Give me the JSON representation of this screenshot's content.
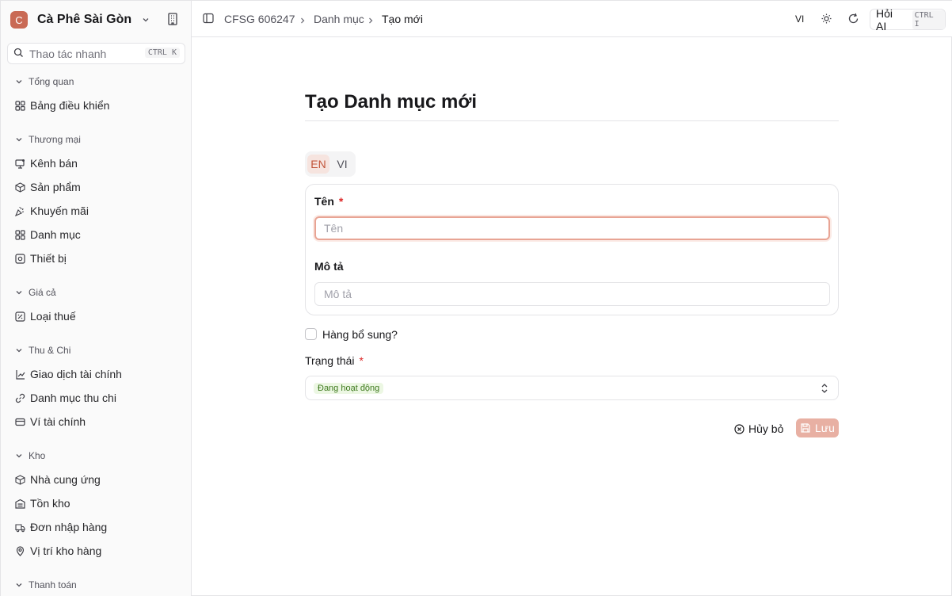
{
  "sidebar": {
    "brand": {
      "logo_letter": "C",
      "name": "Cà Phê Sài Gòn ..."
    },
    "search": {
      "placeholder": "Thao tác nhanh",
      "shortcut": "CTRL K"
    },
    "groups": [
      {
        "label": "Tổng quan",
        "items": [
          {
            "label": "Bảng điều khiển",
            "icon": "dashboard-icon"
          }
        ]
      },
      {
        "label": "Thương mại",
        "items": [
          {
            "label": "Kênh bán",
            "icon": "sales-channel-icon"
          },
          {
            "label": "Sản phẩm",
            "icon": "package-icon"
          },
          {
            "label": "Khuyến mãi",
            "icon": "party-popper-icon"
          },
          {
            "label": "Danh mục",
            "icon": "grid-icon"
          },
          {
            "label": "Thiết bị",
            "icon": "device-icon"
          }
        ]
      },
      {
        "label": "Giá cả",
        "items": [
          {
            "label": "Loại thuế",
            "icon": "tax-icon"
          }
        ]
      },
      {
        "label": "Thu & Chi",
        "items": [
          {
            "label": "Giao dịch tài chính",
            "icon": "transaction-icon"
          },
          {
            "label": "Danh mục thu chi",
            "icon": "link-icon"
          },
          {
            "label": "Ví tài chính",
            "icon": "wallet-icon"
          }
        ]
      },
      {
        "label": "Kho",
        "items": [
          {
            "label": "Nhà cung ứng",
            "icon": "package-icon"
          },
          {
            "label": "Tồn kho",
            "icon": "warehouse-icon"
          },
          {
            "label": "Đơn nhập hàng",
            "icon": "truck-icon"
          },
          {
            "label": "Vị trí kho hàng",
            "icon": "location-icon"
          }
        ]
      },
      {
        "label": "Thanh toán",
        "items": []
      }
    ]
  },
  "topbar": {
    "breadcrumbs": [
      "CFSG 606247",
      "Danh mục",
      "Tạo mới"
    ],
    "language": "VI",
    "ai_button": {
      "label": "Hỏi AI",
      "shortcut": "CTRL I"
    }
  },
  "form": {
    "title": "Tạo Danh mục mới",
    "language_tabs": [
      "EN",
      "VI"
    ],
    "active_language": "EN",
    "name": {
      "label": "Tên",
      "required_mark": "*",
      "placeholder": "Tên",
      "value": ""
    },
    "description": {
      "label": "Mô tả",
      "placeholder": "Mô tả",
      "value": ""
    },
    "addon": {
      "label": "Hàng bổ sung?",
      "checked": false
    },
    "status": {
      "label": "Trạng thái",
      "required_mark": "*",
      "value": "Đang hoạt động"
    },
    "cancel_label": "Hủy bỏ",
    "save_label": "Lưu"
  },
  "colors": {
    "brand": "#c96a55",
    "active_tab_bg": "#f6e4df",
    "save_button": "#e8b0a3",
    "status_badge_bg": "#ecf7e3",
    "status_badge_text": "#3f7a1f"
  }
}
